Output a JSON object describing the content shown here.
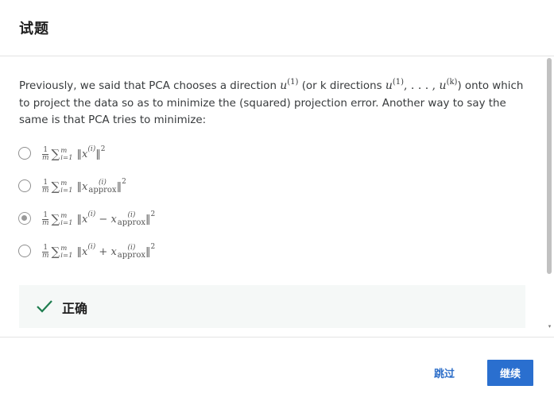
{
  "dialog": {
    "title": "试题",
    "question": {
      "text_part1": "Previously, we said that PCA chooses a direction ",
      "u1": "u",
      "u1_sup": "(1)",
      "text_part2": " (or k directions ",
      "u_list_start": "u",
      "u_list_start_sup": "(1)",
      "u_list_mid": ", . . . , ",
      "u_list_end": "u",
      "u_list_end_sup": "(k)",
      "text_part3": ") onto which to project the data so as to minimize the (squared) projection error. Another way to say the same is that PCA tries to minimize:"
    },
    "options": [
      {
        "label": "1/m ∑ ||x(i)||^2",
        "checked": false
      },
      {
        "label": "1/m ∑ ||x_approx(i)||^2",
        "checked": false
      },
      {
        "label": "1/m ∑ ||x(i) − x_approx(i)||^2",
        "checked": true
      },
      {
        "label": "1/m ∑ ||x(i) + x_approx(i)||^2",
        "checked": false
      }
    ],
    "math": {
      "frac_num": "1",
      "frac_den": "m",
      "sum": "∑",
      "sum_top": "m",
      "sum_bottom": "i=1",
      "norm_open": "‖",
      "norm_close": "‖",
      "x": "x",
      "sup_i": "(i)",
      "approx_sup": "(i)",
      "approx_sub": "approx",
      "squared": "2",
      "minus": "−",
      "plus": "+"
    },
    "feedback": {
      "text": "正确",
      "status_color": "#1e7d4f"
    },
    "footer": {
      "skip_label": "跳过",
      "continue_label": "继续"
    }
  },
  "colors": {
    "accent": "#2a6fcf",
    "link": "#2e6fc9",
    "feedback_bg": "#f5f8f7"
  }
}
